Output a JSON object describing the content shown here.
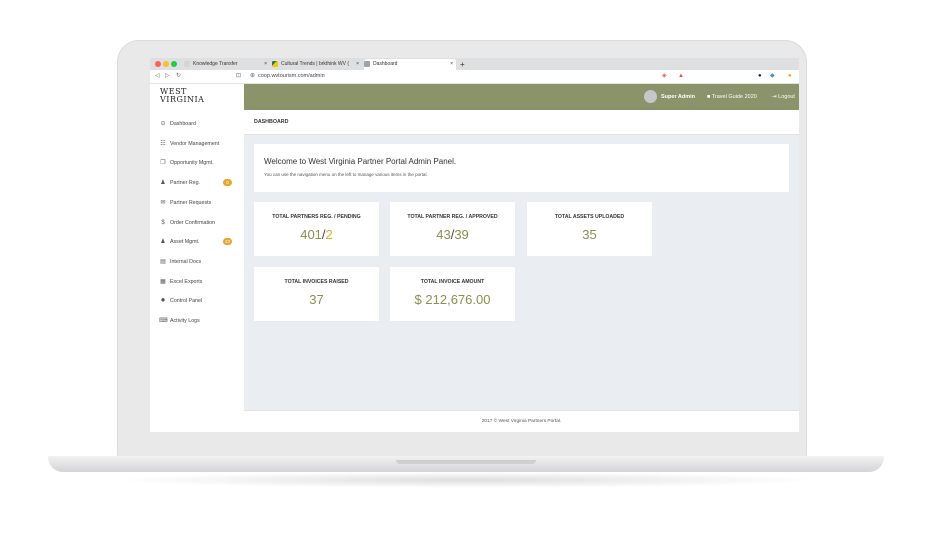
{
  "browser": {
    "tabs": [
      {
        "label": "Knowledge Transfer",
        "icon": "document-icon",
        "active": false
      },
      {
        "label": "Cultural Trends | brkthink WV (",
        "icon": "brkthink-favicon",
        "active": false
      },
      {
        "label": "Dashboard",
        "icon": "page-favicon",
        "active": true
      }
    ],
    "url": "coop.wvtourism.com/admin"
  },
  "logo": {
    "line1": "WEST",
    "line2": "VIRGINIA"
  },
  "sidebar": {
    "items": [
      {
        "label": "Dashboard",
        "icon": "dashboard-icon",
        "glyph": "⊙"
      },
      {
        "label": "Vendor Management",
        "icon": "users-icon",
        "glyph": "☷"
      },
      {
        "label": "Opportunity Mgmt.",
        "icon": "copy-icon",
        "glyph": "❐"
      },
      {
        "label": "Partner Reg.",
        "icon": "user-icon",
        "glyph": "♟",
        "badge": "0"
      },
      {
        "label": "Partner Requests",
        "icon": "envelope-icon",
        "glyph": "✉"
      },
      {
        "label": "Order Confirmation",
        "icon": "dollar-icon",
        "glyph": "$"
      },
      {
        "label": "Asset Mgmt.",
        "icon": "user-icon",
        "glyph": "♟",
        "badge": "23"
      },
      {
        "label": "Internal Docs",
        "icon": "file-icon",
        "glyph": "▤"
      },
      {
        "label": "Excel Exports",
        "icon": "excel-icon",
        "glyph": "▦"
      },
      {
        "label": "Control Panel",
        "icon": "gear-icon",
        "glyph": "✹"
      },
      {
        "label": "Activity Logs",
        "icon": "keyboard-icon",
        "glyph": "⌨"
      }
    ]
  },
  "topbar": {
    "user": "Super Admin",
    "guide": "Travel Guide 2020",
    "logout": "Logout"
  },
  "breadcrumb": "DASHBOARD",
  "welcome": {
    "title": "Welcome to West Virginia Partner Portal Admin Panel.",
    "subtitle": "You can use the navigation menu on the left to manage various items in the portal."
  },
  "stats": [
    {
      "label": "TOTAL PARTNERS REG. / PENDING",
      "value": "401",
      "sep": "/",
      "secondary": "2"
    },
    {
      "label": "TOTAL PARTNER REG. / APPROVED",
      "value": "43",
      "sep": "/",
      "secondary": "39"
    },
    {
      "label": "TOTAL ASSETS UPLOADED",
      "value": "35"
    },
    {
      "label": "TOTAL INVOICES RAISED",
      "value": "37"
    },
    {
      "label": "TOTAL INVOICE AMOUNT",
      "value": "$ 212,676.00"
    }
  ],
  "footer": "2017 © West Virginia Partners Portal.",
  "colors": {
    "topbar": "#8a9369",
    "accent_value": "#8a8e4e",
    "pending": "#e0a82b",
    "badge": "#e6a42f",
    "content_bg": "#eaedf2"
  }
}
